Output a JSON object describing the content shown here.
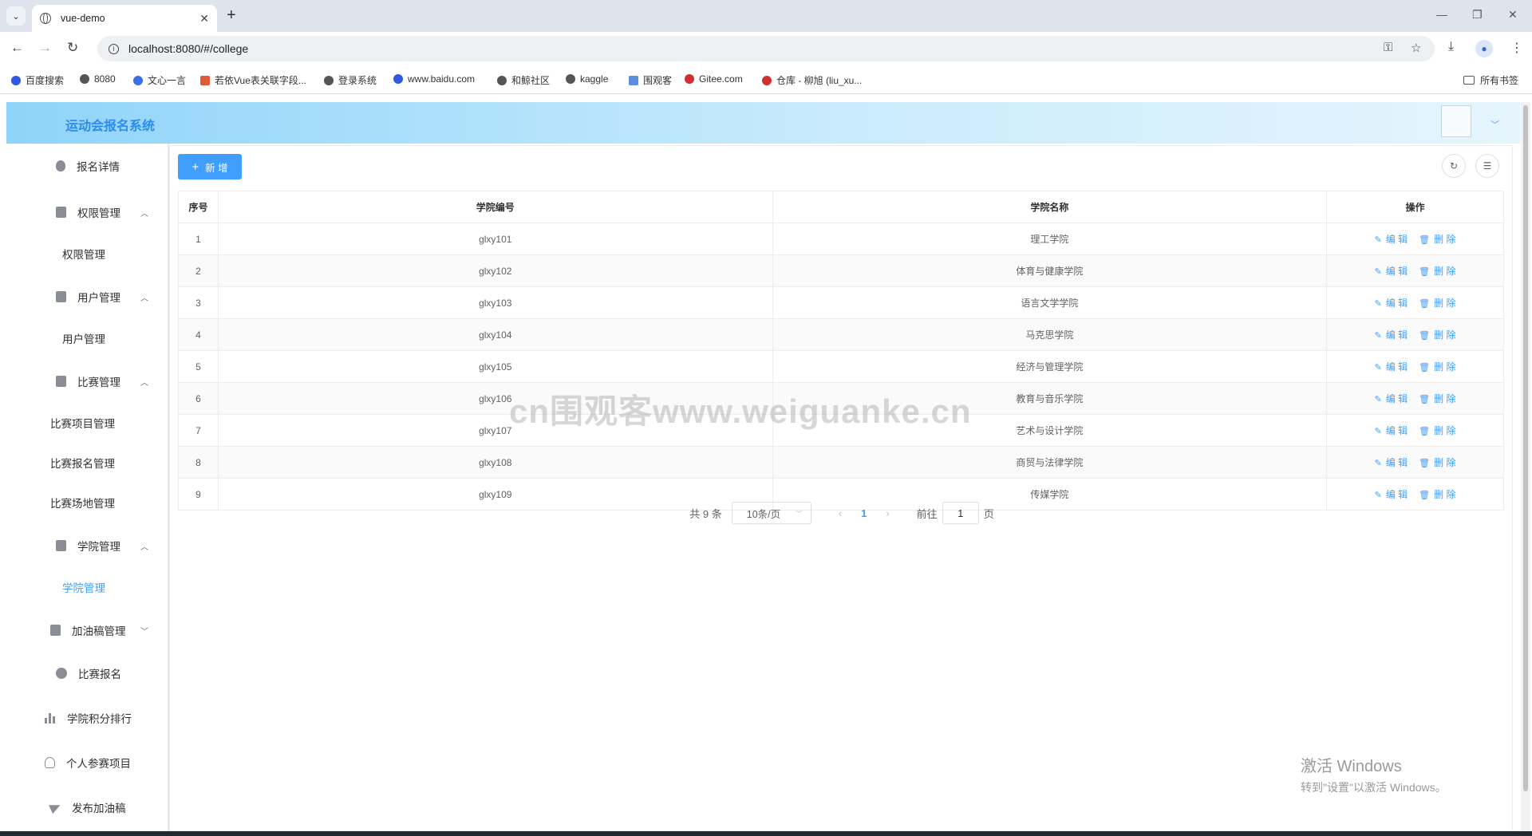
{
  "browser": {
    "tab_title": "vue-demo",
    "url": "localhost:8080/#/college",
    "bookmarks": [
      "百度搜索",
      "8080",
      "文心一言",
      "若依Vue表关联字段...",
      "登录系统",
      "www.baidu.com",
      "和鲸社区",
      "kaggle",
      "围观客",
      "Gitee.com",
      "仓库 - 柳旭 (liu_xu..."
    ],
    "all_bookmarks": "所有书签"
  },
  "app": {
    "title": "运动会报名系统"
  },
  "sidebar": {
    "items": [
      {
        "label": "报名详情"
      },
      {
        "label": "权限管理",
        "children": [
          "权限管理"
        ]
      },
      {
        "label": "用户管理",
        "children": [
          "用户管理"
        ]
      },
      {
        "label": "比赛管理",
        "children": [
          "比赛项目管理",
          "比赛报名管理",
          "比赛场地管理"
        ]
      },
      {
        "label": "学院管理",
        "children": [
          "学院管理"
        ]
      },
      {
        "label": "加油稿管理"
      },
      {
        "label": "比赛报名"
      },
      {
        "label": "学院积分排行"
      },
      {
        "label": "个人参赛项目"
      },
      {
        "label": "发布加油稿"
      }
    ]
  },
  "toolbar": {
    "add_label": "新 增"
  },
  "table": {
    "headers": [
      "序号",
      "学院编号",
      "学院名称",
      "操作"
    ],
    "edit_label": "编 辑",
    "delete_label": "删 除",
    "rows": [
      [
        "1",
        "glxy101",
        "理工学院"
      ],
      [
        "2",
        "glxy102",
        "体育与健康学院"
      ],
      [
        "3",
        "glxy103",
        "语言文学学院"
      ],
      [
        "4",
        "glxy104",
        "马克思学院"
      ],
      [
        "5",
        "glxy105",
        "经济与管理学院"
      ],
      [
        "6",
        "glxy106",
        "教育与音乐学院"
      ],
      [
        "7",
        "glxy107",
        "艺术与设计学院"
      ],
      [
        "8",
        "glxy108",
        "商贸与法律学院"
      ],
      [
        "9",
        "glxy109",
        "传媒学院"
      ]
    ]
  },
  "pagination": {
    "total": "共 9 条",
    "page_size": "10条/页",
    "current_page": "1",
    "goto_prefix": "前往",
    "goto_value": "1",
    "goto_suffix": "页"
  },
  "watermark": "cn围观客www.weiguanke.cn",
  "os_notice": {
    "line1": "激活 Windows",
    "line2": "转到\"设置\"以激活 Windows。"
  }
}
